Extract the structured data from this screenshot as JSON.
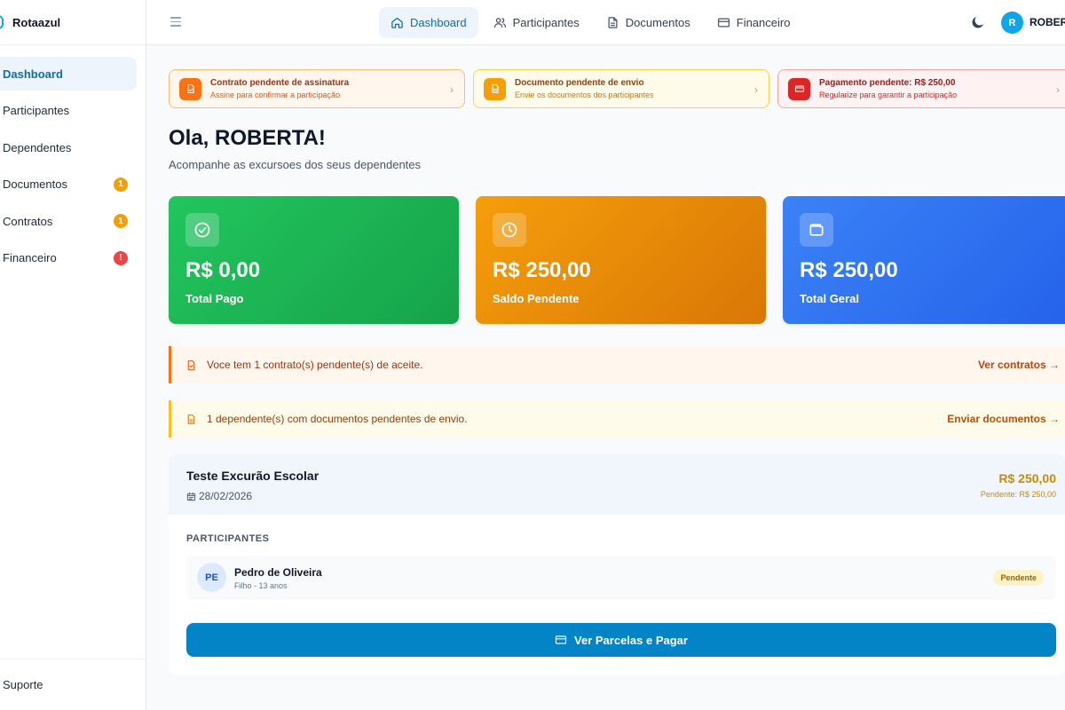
{
  "brand": {
    "name": "Rotaazul"
  },
  "sidebar": {
    "items": [
      {
        "label": "Dashboard",
        "active": true,
        "badge": ""
      },
      {
        "label": "Participantes",
        "active": false,
        "badge": ""
      },
      {
        "label": "Dependentes",
        "active": false,
        "badge": ""
      },
      {
        "label": "Documentos",
        "active": false,
        "badge": "1"
      },
      {
        "label": "Contratos",
        "active": false,
        "badge": "1"
      },
      {
        "label": "Financeiro",
        "active": false,
        "badge": "!"
      }
    ],
    "support_label": "Suporte"
  },
  "topbar": {
    "nav": [
      {
        "label": "Dashboard",
        "icon": "home-icon",
        "active": true
      },
      {
        "label": "Participantes",
        "icon": "users-icon",
        "active": false
      },
      {
        "label": "Documentos",
        "icon": "document-icon",
        "active": false
      },
      {
        "label": "Financeiro",
        "icon": "credit-card-icon",
        "active": false
      }
    ],
    "avatar_initial": "R",
    "username": "ROBERTA"
  },
  "alerts": [
    {
      "title": "Contrato pendente de assinatura",
      "subtitle": "Assine para confirmar a participação",
      "icon": "file-signature-icon",
      "color": "#f97316"
    },
    {
      "title": "Documento pendente de envio",
      "subtitle": "Envie os documentos dos participantes",
      "icon": "file-icon",
      "color": "#f59e0b"
    },
    {
      "title": "Pagamento pendente: R$ 250,00",
      "subtitle": "Regularize para garantir a participação",
      "icon": "credit-card-icon",
      "color": "#dc2626"
    }
  ],
  "greeting": {
    "title": "Ola, ROBERTA!",
    "subtitle": "Acompanhe as excursoes dos seus dependentes"
  },
  "stats": [
    {
      "value": "R$ 0,00",
      "label": "Total Pago",
      "icon": "check-circle-icon"
    },
    {
      "value": "R$ 250,00",
      "label": "Saldo Pendente",
      "icon": "clock-icon"
    },
    {
      "value": "R$ 250,00",
      "label": "Total Geral",
      "icon": "wallet-icon"
    }
  ],
  "notices": [
    {
      "text": "Voce tem 1 contrato(s) pendente(s) de aceite.",
      "link": "Ver contratos →"
    },
    {
      "text": "1 dependente(s) com documentos pendentes de envio.",
      "link": "Enviar documentos →"
    }
  ],
  "trip": {
    "title": "Teste Excurão Escolar",
    "date": "28/02/2026",
    "amount": "R$ 250,00",
    "pending": "Pendente: R$ 250,00",
    "participants_label": "PARTICIPANTES",
    "participants": [
      {
        "initials": "PE",
        "name": "Pedro de Oliveira",
        "info": "Filho - 13 anos",
        "status": "Pendente"
      }
    ],
    "pay_button": "Ver Parcelas e Pagar"
  },
  "colors": {
    "accent": "#0b6db3",
    "primary_button": "#0284c7",
    "stat_green": "#22c55e",
    "stat_orange": "#f59e0b",
    "stat_blue": "#3b82f6"
  }
}
